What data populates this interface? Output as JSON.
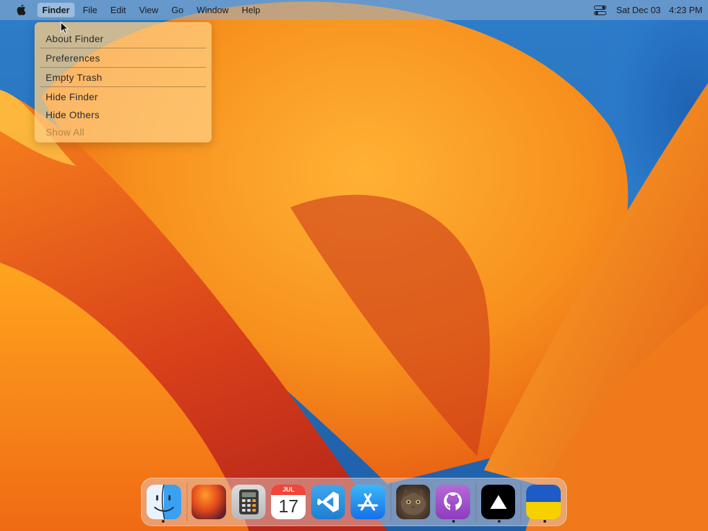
{
  "menubar": {
    "apple_icon": "apple-logo-icon",
    "items": [
      "Finder",
      "File",
      "Edit",
      "View",
      "Go",
      "Window",
      "Help"
    ],
    "control_center_icon": "control-center-icon",
    "date": "Sat Dec 03",
    "time": "4:23 PM"
  },
  "finder_menu": {
    "items": [
      {
        "label": "About Finder",
        "enabled": true
      },
      {
        "label": "Preferences",
        "enabled": true
      },
      {
        "label": "Empty Trash",
        "enabled": true
      },
      {
        "label": "Hide Finder",
        "enabled": true
      },
      {
        "label": "Hide Others",
        "enabled": true
      },
      {
        "label": "Show All",
        "enabled": false
      }
    ]
  },
  "dock": {
    "apps": [
      {
        "name": "finder-icon",
        "running": true
      },
      {
        "name": "macos-ventura-icon",
        "running": false
      },
      {
        "name": "calculator-icon",
        "running": false
      },
      {
        "name": "calendar-icon",
        "running": false,
        "month": "JUL",
        "day": "17"
      },
      {
        "name": "vscode-icon",
        "running": false
      },
      {
        "name": "app-store-icon",
        "running": false
      },
      {
        "name": "cat-photo-icon",
        "running": false
      },
      {
        "name": "github-icon",
        "running": true
      },
      {
        "name": "vercel-icon",
        "running": true
      },
      {
        "name": "ukraine-flag-icon",
        "running": true
      }
    ]
  },
  "colors": {
    "wallpaper_orange": "#f7941d",
    "wallpaper_blue": "#2a6fb5",
    "menu_bg": "#ffcd82"
  }
}
